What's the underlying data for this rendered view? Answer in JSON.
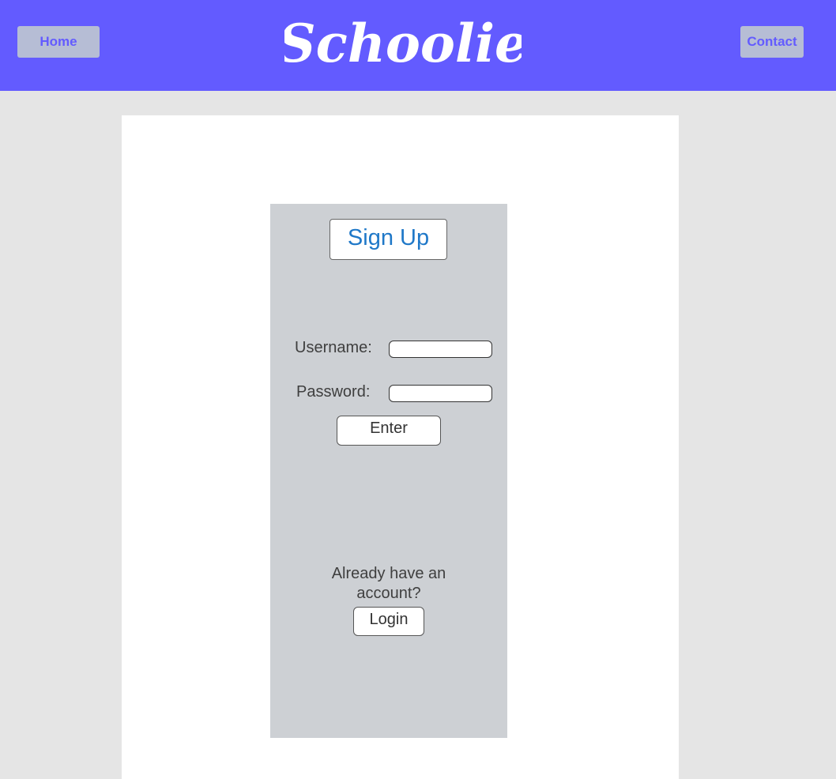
{
  "header": {
    "brand": "Schoolie",
    "nav": {
      "home_label": "Home",
      "contact_label": "Contact"
    }
  },
  "signup": {
    "title": "Sign Up",
    "username_label": "Username:",
    "username_value": "",
    "password_label": "Password:",
    "password_value": "",
    "enter_label": "Enter",
    "already_text": "Already have an account?",
    "login_label": "Login"
  },
  "colors": {
    "header_bg": "#635bff",
    "nav_button_bg": "#b6bdd5",
    "page_bg": "#e5e5e5",
    "card_bg": "#ffffff",
    "panel_bg": "#cdd0d4",
    "title_color": "#1f78c8"
  }
}
